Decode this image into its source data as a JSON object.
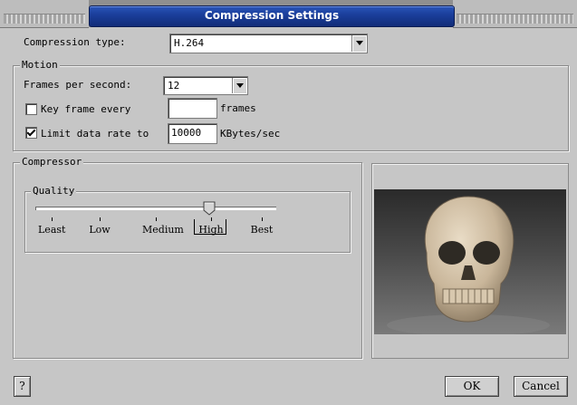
{
  "window": {
    "title": "Compression Settings"
  },
  "compression_type": {
    "label": "Compression type:",
    "value": "H.264"
  },
  "motion": {
    "title": "Motion",
    "fps_label": "Frames per second:",
    "fps_value": "12",
    "keyframe": {
      "label": "Key frame every",
      "checked": false,
      "value": "",
      "unit": "frames"
    },
    "limit_rate": {
      "label": "Limit data rate to",
      "checked": true,
      "value": "10000",
      "unit": "KBytes/sec"
    }
  },
  "compressor": {
    "title": "Compressor",
    "quality": {
      "title": "Quality",
      "levels": [
        "Least",
        "Low",
        "Medium",
        "High",
        "Best"
      ],
      "selected": "High",
      "selected_index": 3
    }
  },
  "preview": {
    "icon": "skull-preview-image"
  },
  "buttons": {
    "help": "?",
    "ok": "OK",
    "cancel": "Cancel"
  }
}
